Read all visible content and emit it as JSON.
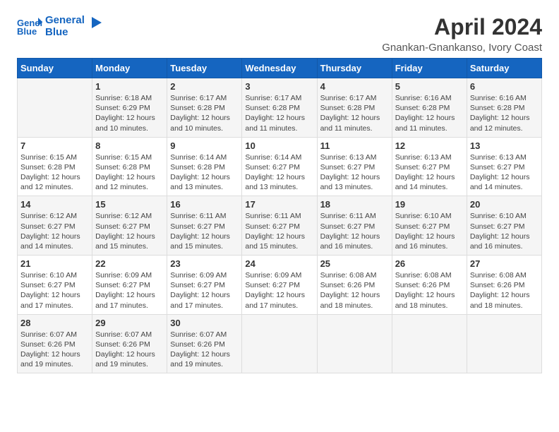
{
  "header": {
    "logo_line1": "General",
    "logo_line2": "Blue",
    "title": "April 2024",
    "subtitle": "Gnankan-Gnankanso, Ivory Coast"
  },
  "days_of_week": [
    "Sunday",
    "Monday",
    "Tuesday",
    "Wednesday",
    "Thursday",
    "Friday",
    "Saturday"
  ],
  "weeks": [
    [
      {
        "day": "",
        "sunrise": "",
        "sunset": "",
        "daylight": ""
      },
      {
        "day": "1",
        "sunrise": "6:18 AM",
        "sunset": "6:29 PM",
        "daylight": "12 hours and 10 minutes."
      },
      {
        "day": "2",
        "sunrise": "6:17 AM",
        "sunset": "6:28 PM",
        "daylight": "12 hours and 10 minutes."
      },
      {
        "day": "3",
        "sunrise": "6:17 AM",
        "sunset": "6:28 PM",
        "daylight": "12 hours and 11 minutes."
      },
      {
        "day": "4",
        "sunrise": "6:17 AM",
        "sunset": "6:28 PM",
        "daylight": "12 hours and 11 minutes."
      },
      {
        "day": "5",
        "sunrise": "6:16 AM",
        "sunset": "6:28 PM",
        "daylight": "12 hours and 11 minutes."
      },
      {
        "day": "6",
        "sunrise": "6:16 AM",
        "sunset": "6:28 PM",
        "daylight": "12 hours and 12 minutes."
      }
    ],
    [
      {
        "day": "7",
        "sunrise": "6:15 AM",
        "sunset": "6:28 PM",
        "daylight": "12 hours and 12 minutes."
      },
      {
        "day": "8",
        "sunrise": "6:15 AM",
        "sunset": "6:28 PM",
        "daylight": "12 hours and 12 minutes."
      },
      {
        "day": "9",
        "sunrise": "6:14 AM",
        "sunset": "6:28 PM",
        "daylight": "12 hours and 13 minutes."
      },
      {
        "day": "10",
        "sunrise": "6:14 AM",
        "sunset": "6:27 PM",
        "daylight": "12 hours and 13 minutes."
      },
      {
        "day": "11",
        "sunrise": "6:13 AM",
        "sunset": "6:27 PM",
        "daylight": "12 hours and 13 minutes."
      },
      {
        "day": "12",
        "sunrise": "6:13 AM",
        "sunset": "6:27 PM",
        "daylight": "12 hours and 14 minutes."
      },
      {
        "day": "13",
        "sunrise": "6:13 AM",
        "sunset": "6:27 PM",
        "daylight": "12 hours and 14 minutes."
      }
    ],
    [
      {
        "day": "14",
        "sunrise": "6:12 AM",
        "sunset": "6:27 PM",
        "daylight": "12 hours and 14 minutes."
      },
      {
        "day": "15",
        "sunrise": "6:12 AM",
        "sunset": "6:27 PM",
        "daylight": "12 hours and 15 minutes."
      },
      {
        "day": "16",
        "sunrise": "6:11 AM",
        "sunset": "6:27 PM",
        "daylight": "12 hours and 15 minutes."
      },
      {
        "day": "17",
        "sunrise": "6:11 AM",
        "sunset": "6:27 PM",
        "daylight": "12 hours and 15 minutes."
      },
      {
        "day": "18",
        "sunrise": "6:11 AM",
        "sunset": "6:27 PM",
        "daylight": "12 hours and 16 minutes."
      },
      {
        "day": "19",
        "sunrise": "6:10 AM",
        "sunset": "6:27 PM",
        "daylight": "12 hours and 16 minutes."
      },
      {
        "day": "20",
        "sunrise": "6:10 AM",
        "sunset": "6:27 PM",
        "daylight": "12 hours and 16 minutes."
      }
    ],
    [
      {
        "day": "21",
        "sunrise": "6:10 AM",
        "sunset": "6:27 PM",
        "daylight": "12 hours and 17 minutes."
      },
      {
        "day": "22",
        "sunrise": "6:09 AM",
        "sunset": "6:27 PM",
        "daylight": "12 hours and 17 minutes."
      },
      {
        "day": "23",
        "sunrise": "6:09 AM",
        "sunset": "6:27 PM",
        "daylight": "12 hours and 17 minutes."
      },
      {
        "day": "24",
        "sunrise": "6:09 AM",
        "sunset": "6:27 PM",
        "daylight": "12 hours and 17 minutes."
      },
      {
        "day": "25",
        "sunrise": "6:08 AM",
        "sunset": "6:26 PM",
        "daylight": "12 hours and 18 minutes."
      },
      {
        "day": "26",
        "sunrise": "6:08 AM",
        "sunset": "6:26 PM",
        "daylight": "12 hours and 18 minutes."
      },
      {
        "day": "27",
        "sunrise": "6:08 AM",
        "sunset": "6:26 PM",
        "daylight": "12 hours and 18 minutes."
      }
    ],
    [
      {
        "day": "28",
        "sunrise": "6:07 AM",
        "sunset": "6:26 PM",
        "daylight": "12 hours and 19 minutes."
      },
      {
        "day": "29",
        "sunrise": "6:07 AM",
        "sunset": "6:26 PM",
        "daylight": "12 hours and 19 minutes."
      },
      {
        "day": "30",
        "sunrise": "6:07 AM",
        "sunset": "6:26 PM",
        "daylight": "12 hours and 19 minutes."
      },
      {
        "day": "",
        "sunrise": "",
        "sunset": "",
        "daylight": ""
      },
      {
        "day": "",
        "sunrise": "",
        "sunset": "",
        "daylight": ""
      },
      {
        "day": "",
        "sunrise": "",
        "sunset": "",
        "daylight": ""
      },
      {
        "day": "",
        "sunrise": "",
        "sunset": "",
        "daylight": ""
      }
    ]
  ],
  "labels": {
    "sunrise_prefix": "Sunrise: ",
    "sunset_prefix": "Sunset: ",
    "daylight_prefix": "Daylight: "
  }
}
